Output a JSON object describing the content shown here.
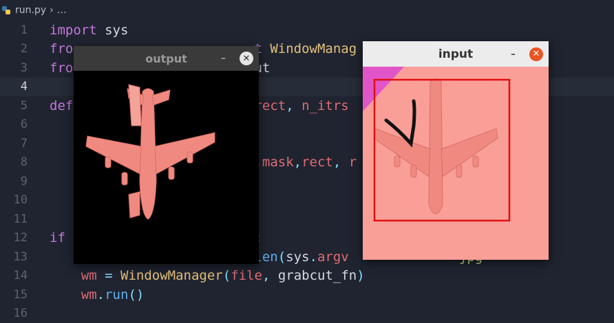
{
  "breadcrumb": {
    "file": "run.py",
    "sep": "›",
    "rest": "…"
  },
  "code_lines": [
    {
      "n": "1",
      "html": "<span class='kw'>import</span> <span class='id'>sys</span>"
    },
    {
      "n": "2",
      "html": "<span class='kw'>fro</span>                       <span class='kw'>t</span> <span class='fn'>WindowManag</span>"
    },
    {
      "n": "3",
      "html": "<span class='kw'>fro</span>                       <span class='id'>ut</span>"
    },
    {
      "n": "4",
      "html": "",
      "current": true
    },
    {
      "n": "5",
      "html": "<span class='kw'>def</span>                       <span class='var'>rect</span><span class='op'>,</span> <span class='var'>n_itrs</span>"
    },
    {
      "n": "6",
      "html": ""
    },
    {
      "n": "7",
      "html": ""
    },
    {
      "n": "8",
      "html": "                          <span class='op'>,</span><span class='var'>mask</span><span class='op'>,</span><span class='var'>rect</span><span class='op'>,</span> <span class='var'>r</span>"
    },
    {
      "n": "9",
      "html": ""
    },
    {
      "n": "10",
      "html": ""
    },
    {
      "n": "11",
      "html": ""
    },
    {
      "n": "12",
      "html": "<span class='kw'>if</span>                        <span class='op'>:</span>"
    },
    {
      "n": "13",
      "html": "                          <span class='call'>len</span><span class='op'>(</span><span class='id'>sys</span><span class='op'>.</span><span class='var'>argv</span>              <span class='str'>jpg\"</span>"
    },
    {
      "n": "14",
      "html": "    <span class='var'>wm</span> <span class='op'>=</span> <span class='fn'>WindowManager</span><span class='op'>(</span><span class='var'>file</span><span class='op'>,</span> <span class='id'>grabcut_fn</span><span class='op'>)</span>"
    },
    {
      "n": "15",
      "html": "    <span class='var'>wm</span><span class='op'>.</span><span class='call'>run</span><span class='op'>()</span>"
    },
    {
      "n": "16",
      "html": ""
    }
  ],
  "output_window": {
    "title": "output",
    "min": "–",
    "close": "✕"
  },
  "input_window": {
    "title": "input",
    "min": "–",
    "close": "✕"
  },
  "colors": {
    "editor_bg": "#1f2430",
    "selection_rect": "#e01010",
    "image_bg": "#fa9f97",
    "plane": "#f08a80"
  }
}
